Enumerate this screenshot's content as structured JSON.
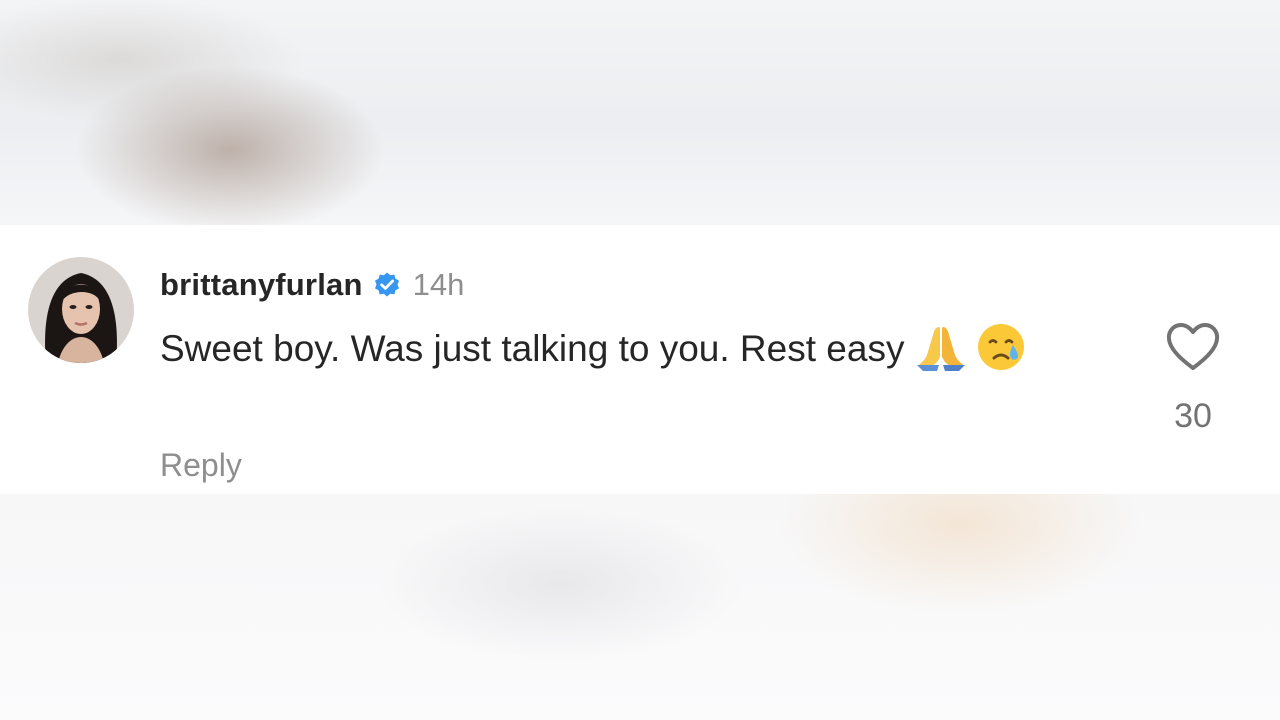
{
  "comment": {
    "username": "brittanyfurlan",
    "verified_icon": "verified-badge-icon",
    "timestamp": "14h",
    "text": "Sweet boy. Was just talking to you. Rest easy",
    "emojis": [
      "folded-hands-icon",
      "crying-face-icon"
    ],
    "reply_label": "Reply",
    "like_icon": "heart-outline-icon",
    "like_count": "30"
  },
  "colors": {
    "primary_text": "#262626",
    "secondary_text": "#8e8e8e",
    "verified_blue": "#3797f0"
  }
}
